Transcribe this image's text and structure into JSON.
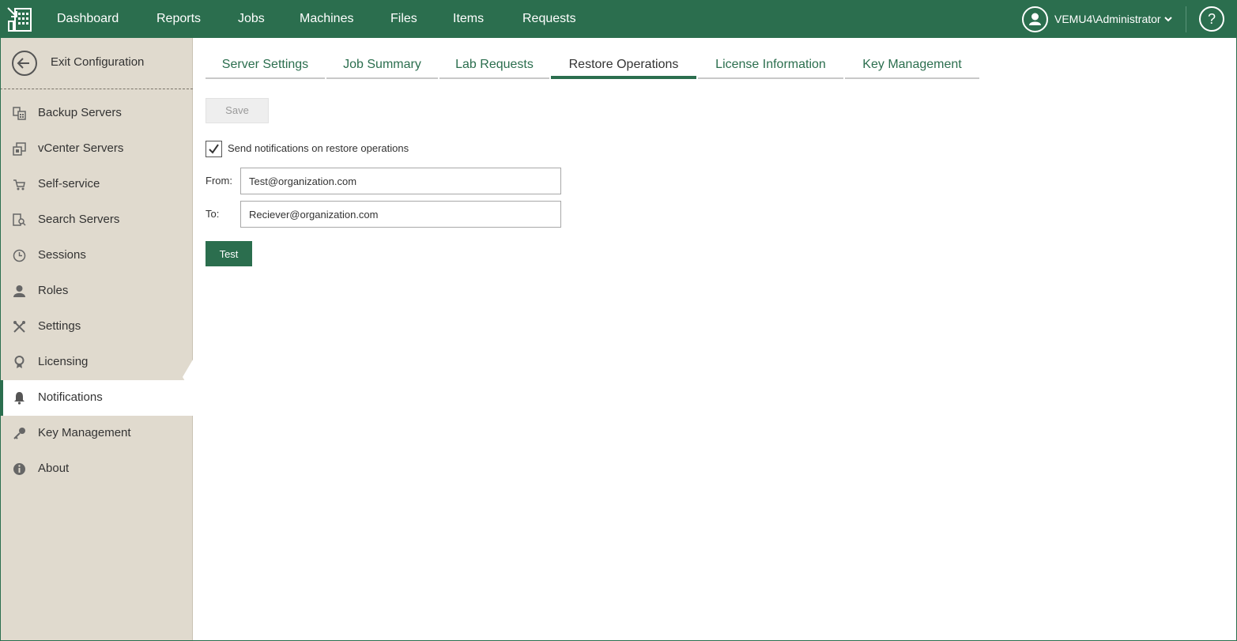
{
  "topnav": {
    "items": [
      "Dashboard",
      "Reports",
      "Jobs",
      "Machines",
      "Files",
      "Items",
      "Requests"
    ],
    "user": "VEMU4\\Administrator",
    "help": "?"
  },
  "sidebar": {
    "exit_label": "Exit Configuration",
    "items": [
      {
        "label": "Backup Servers",
        "icon": "backup-servers-icon"
      },
      {
        "label": "vCenter Servers",
        "icon": "vcenter-icon"
      },
      {
        "label": "Self-service",
        "icon": "cart-icon"
      },
      {
        "label": "Search Servers",
        "icon": "search-servers-icon"
      },
      {
        "label": "Sessions",
        "icon": "clock-icon"
      },
      {
        "label": "Roles",
        "icon": "person-icon"
      },
      {
        "label": "Settings",
        "icon": "tools-icon"
      },
      {
        "label": "Licensing",
        "icon": "license-icon"
      },
      {
        "label": "Notifications",
        "icon": "bell-icon",
        "active": true
      },
      {
        "label": "Key Management",
        "icon": "key-icon"
      },
      {
        "label": "About",
        "icon": "info-icon"
      }
    ]
  },
  "tabs": [
    "Server Settings",
    "Job Summary",
    "Lab Requests",
    "Restore Operations",
    "License Information",
    "Key Management"
  ],
  "active_tab": "Restore Operations",
  "form": {
    "save_label": "Save",
    "checkbox_label": "Send notifications on restore operations",
    "checkbox_checked": true,
    "from_label": "From:",
    "from_value": "Test@organization.com",
    "to_label": "To:",
    "to_value": "Reciever@organization.com",
    "test_label": "Test"
  },
  "colors": {
    "brand": "#2b6e4e",
    "sidebar_bg": "#e0dace"
  }
}
